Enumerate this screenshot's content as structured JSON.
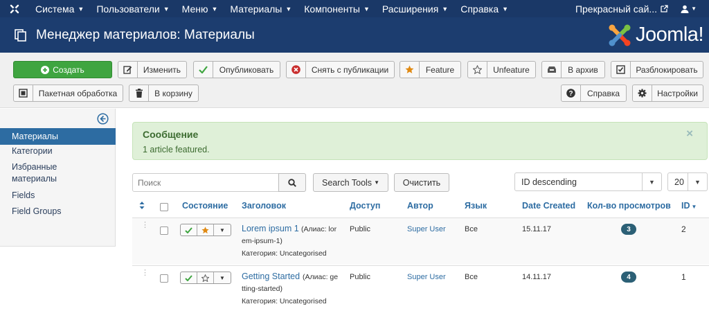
{
  "topnav": {
    "menu": [
      {
        "label": "Система"
      },
      {
        "label": "Пользователи"
      },
      {
        "label": "Меню"
      },
      {
        "label": "Материалы"
      },
      {
        "label": "Компоненты"
      },
      {
        "label": "Расширения"
      },
      {
        "label": "Справка"
      }
    ],
    "site_name": "Прекрасный сай...",
    "user_icon": "user-icon"
  },
  "header": {
    "title": "Менеджер материалов: Материалы",
    "logo_text": "Joomla!"
  },
  "toolbar": {
    "create": "Создать",
    "edit": "Изменить",
    "publish": "Опубликовать",
    "unpublish": "Снять с публикации",
    "feature": "Feature",
    "unfeature": "Unfeature",
    "archive": "В архив",
    "checkin": "Разблокировать",
    "batch": "Пакетная обработка",
    "trash": "В корзину",
    "help": "Справка",
    "options": "Настройки"
  },
  "sidebar": {
    "items": [
      {
        "label": "Материалы",
        "active": true
      },
      {
        "label": "Категории"
      },
      {
        "label": "Избранные материалы"
      },
      {
        "label": "Fields"
      },
      {
        "label": "Field Groups"
      }
    ]
  },
  "alert": {
    "heading": "Сообщение",
    "message": "1 article featured.",
    "close": "×"
  },
  "filters": {
    "search_placeholder": "Поиск",
    "search_tools": "Search Tools",
    "clear": "Очистить",
    "ordering": "ID descending",
    "limit": "20"
  },
  "table": {
    "columns": {
      "status": "Состояние",
      "title": "Заголовок",
      "access": "Доступ",
      "author": "Автор",
      "language": "Язык",
      "date_created": "Date Created",
      "hits": "Кол-во просмотров",
      "id": "ID"
    },
    "rows": [
      {
        "title": "Lorem ipsum 1",
        "alias_line1": "(Алиас: lor",
        "alias_line2": "em-ipsum-1)",
        "category": "Категория: Uncategorised",
        "access": "Public",
        "author": "Super User",
        "language": "Все",
        "date": "15.11.17",
        "hits": "3",
        "id": "2",
        "featured": true
      },
      {
        "title": "Getting Started",
        "alias_line1": "(Алиас: ge",
        "alias_line2": "tting-started)",
        "category": "Категория: Uncategorised",
        "access": "Public",
        "author": "Super User",
        "language": "Все",
        "date": "14.11.17",
        "hits": "4",
        "id": "1",
        "featured": false
      }
    ]
  },
  "colors": {
    "topnav_bg": "#1a3867",
    "header_bg": "#1c3d6f",
    "create_green": "#3fa540",
    "link_blue": "#2d6ca2",
    "sidebar_active": "#2d6ca2",
    "alert_bg": "#dff0d8",
    "badge": "#2c6076"
  }
}
